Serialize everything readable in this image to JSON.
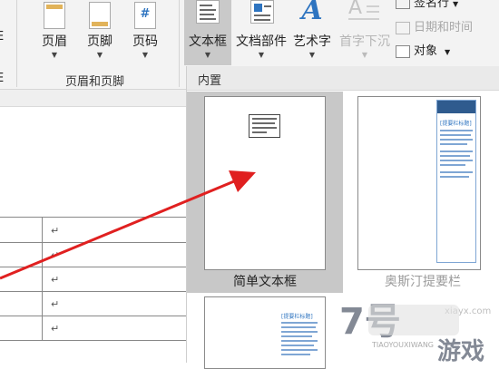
{
  "ribbon": {
    "header_footer": {
      "header_label": "页眉",
      "footer_label": "页脚",
      "page_number_label": "页码",
      "group_label": "页眉和页脚",
      "page_number_glyph": "#"
    },
    "text": {
      "textbox_label": "文本框",
      "quick_parts_label": "文档部件",
      "wordart_label": "艺术字",
      "dropcap_label": "首字下沉",
      "signature_line_label": "签名行",
      "date_time_label": "日期和时间",
      "object_label": "对象",
      "wordart_glyph": "A"
    },
    "cut_left_top": "E",
    "cut_left_bottom": "E"
  },
  "gallery": {
    "section_title": "内置",
    "items": [
      {
        "caption": "简单文本框",
        "selected": true
      },
      {
        "caption": "奥斯汀提要栏",
        "selected": false,
        "sidebar_title": "[提要栏标题]"
      },
      {
        "caption": "",
        "selected": false,
        "sidebar_title": "[提要栏标题]"
      }
    ]
  },
  "document": {
    "return_mark": "↵"
  },
  "watermark": {
    "text_cn": "游戏",
    "text_en": "TIAOYOUXIWANG",
    "domain": "xiayx.com",
    "logo_glyph": "7号"
  },
  "colors": {
    "annotation_arrow": "#e02020",
    "accent_blue": "#2e74c0",
    "austin_header": "#2f5b8e"
  }
}
